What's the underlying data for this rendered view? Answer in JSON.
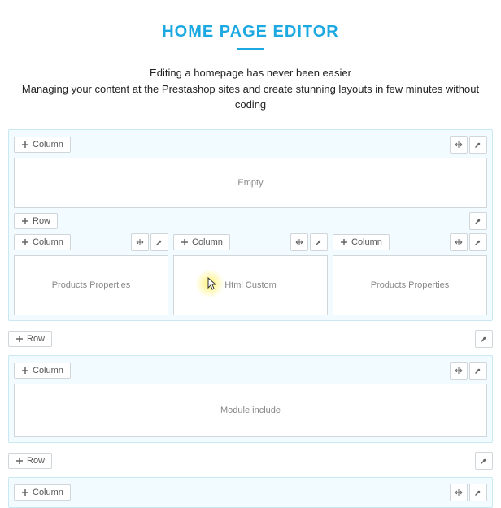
{
  "header": {
    "title": "HOME PAGE EDITOR",
    "subtitle_line1": "Editing a homepage has never been easier",
    "subtitle_line2": "Managing your content at the Prestashop sites and create stunning layouts in few minutes without coding"
  },
  "labels": {
    "add_column": "Column",
    "add_row": "Row"
  },
  "blocks": {
    "empty": "Empty",
    "products_properties": "Products Properties",
    "html_custom": "Html Custom",
    "module_include": "Module include"
  }
}
